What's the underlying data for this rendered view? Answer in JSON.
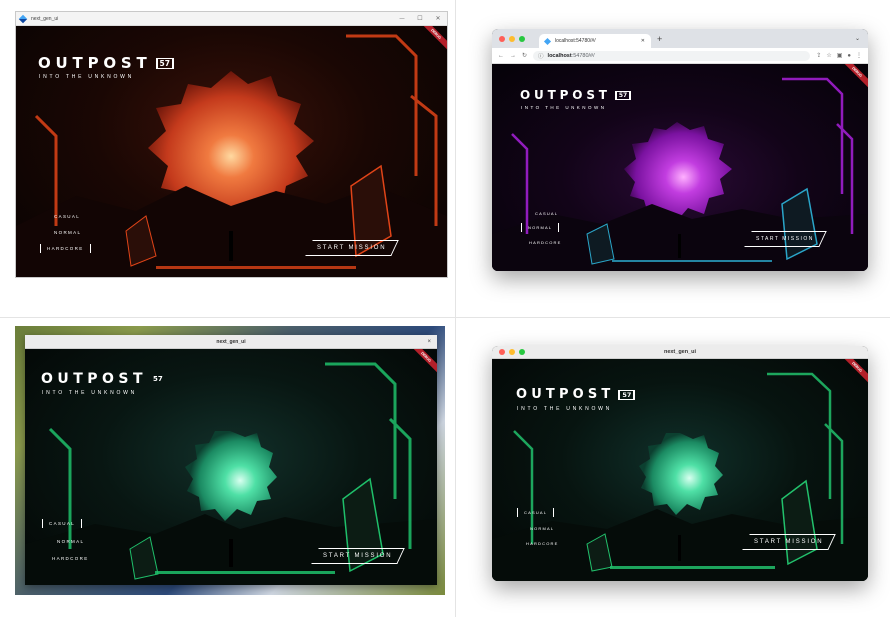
{
  "game": {
    "title": "OUTPOST",
    "number": "57",
    "tagline": "INTO THE UNKNOWN",
    "difficulties": [
      "CASUAL",
      "NORMAL",
      "HARDCORE"
    ],
    "start_label": "START MISSION",
    "debug_banner": "DEBUG"
  },
  "windows": {
    "windows_app": {
      "title": "next_gen_ui",
      "controls": [
        "—",
        "☐",
        "✕"
      ],
      "selected": "HARDCORE",
      "accent": "#e04418"
    },
    "chrome": {
      "tab_title": "localhost:54780/#/",
      "url_host": "localhost",
      "url_rest": ":54780/#/",
      "selected": "NORMAL",
      "accent": "#a01fd0"
    },
    "linux_app": {
      "title": "next_gen_ui",
      "close": "×",
      "selected": "CASUAL",
      "accent": "#1fbf6a"
    },
    "mac_app": {
      "title": "next_gen_ui",
      "selected": "CASUAL",
      "accent": "#22c16c"
    }
  }
}
